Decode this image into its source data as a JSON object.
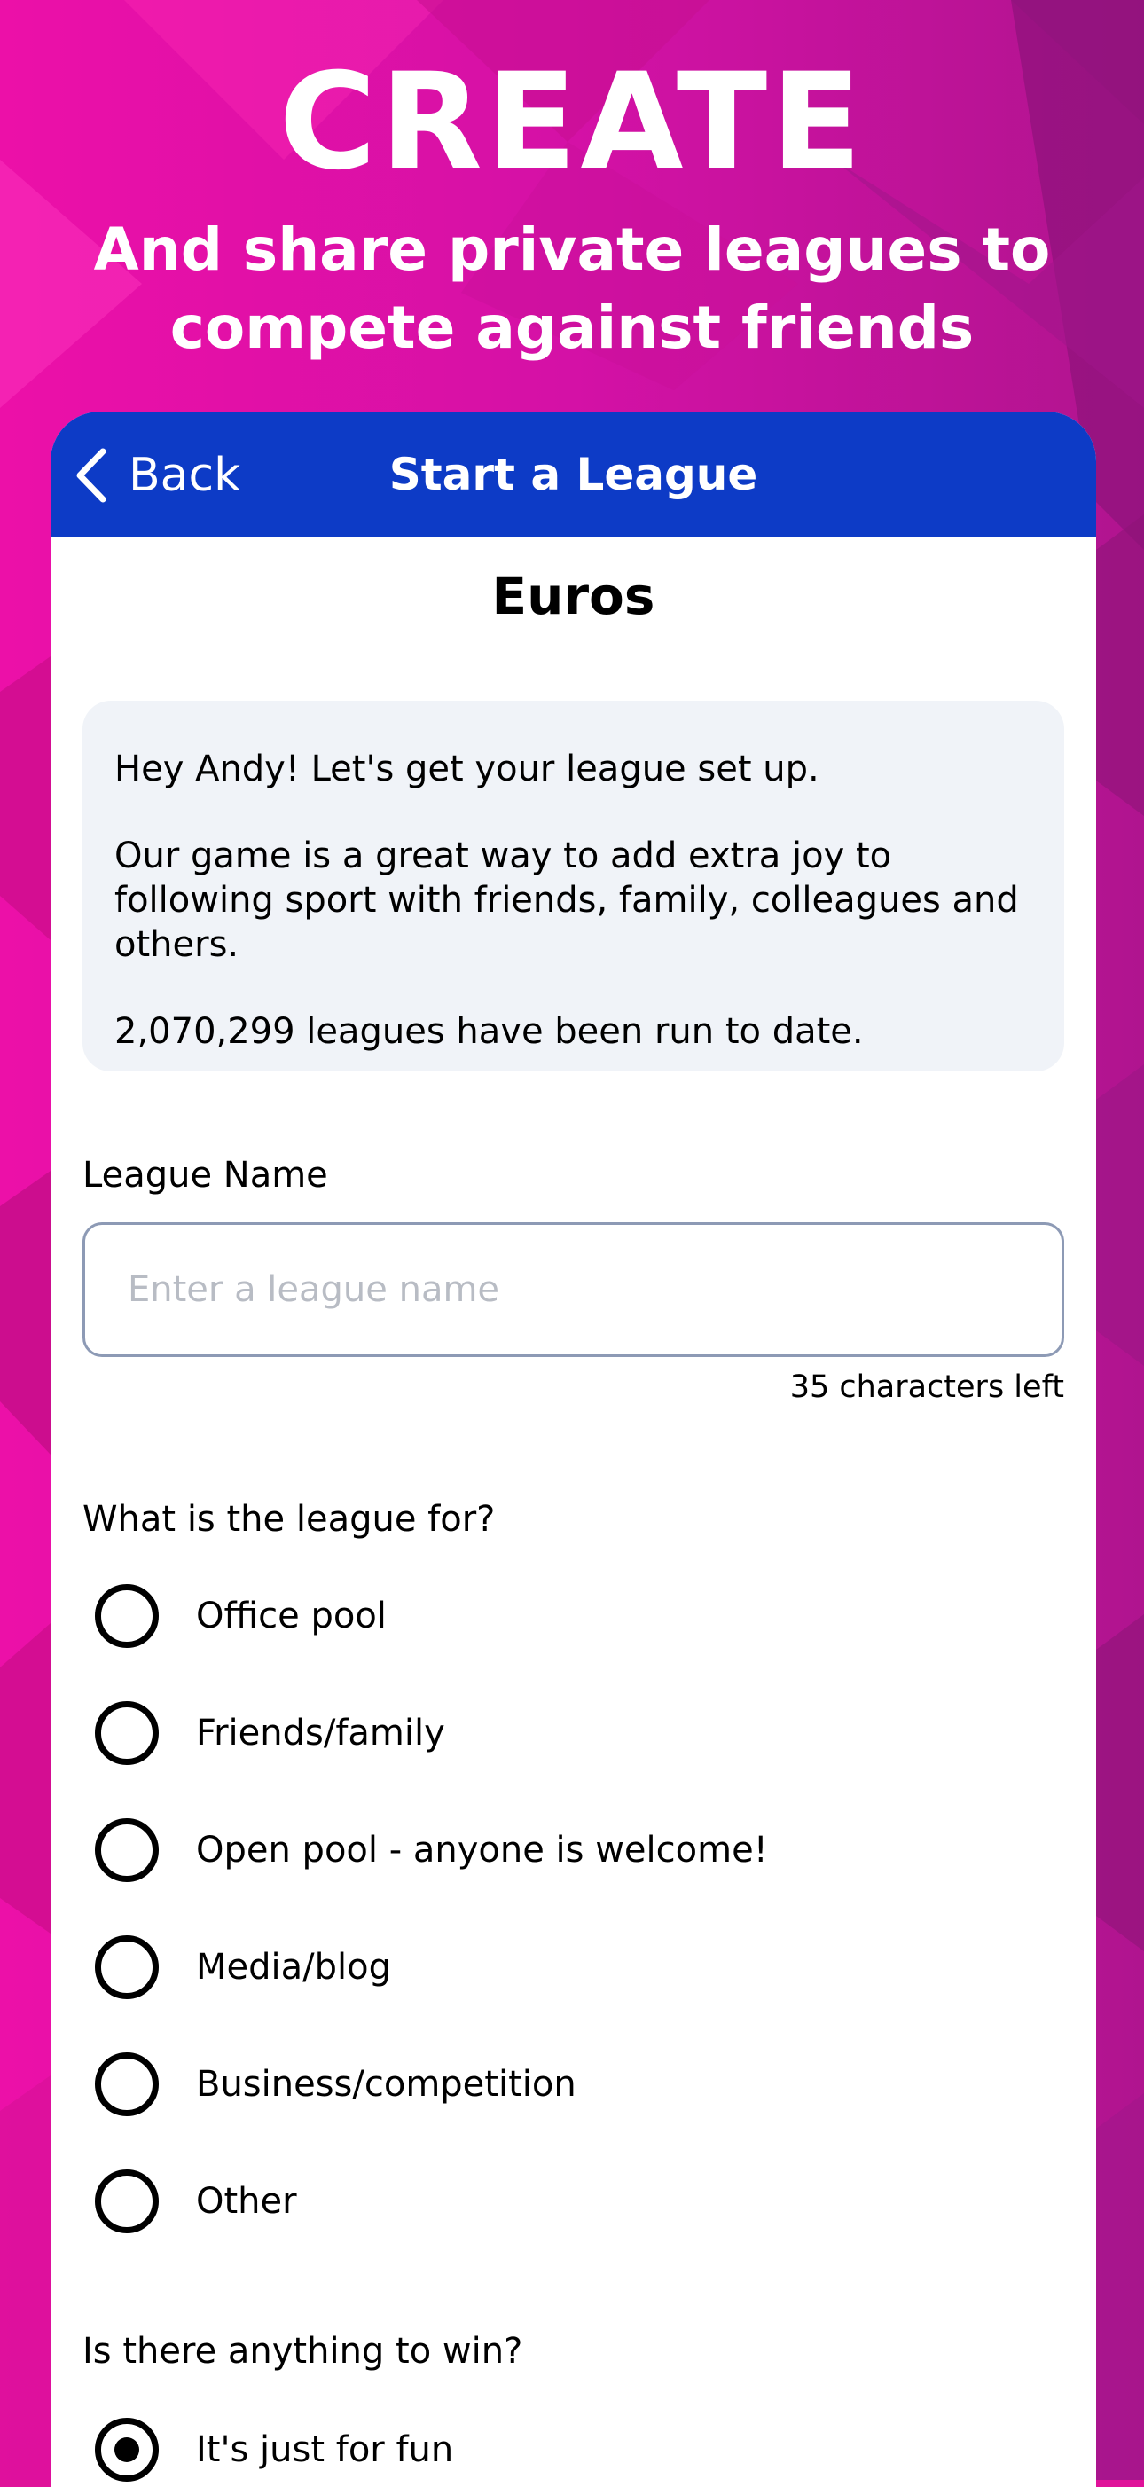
{
  "promo": {
    "title": "CREATE",
    "subtitle_line1": "And share private leagues to",
    "subtitle_line2": "compete against friends"
  },
  "colors": {
    "background_magenta": "#e0129a",
    "navbar_blue": "#0d3bc6",
    "info_box": "#f0f3f8"
  },
  "navbar": {
    "back_label": "Back",
    "back_icon": "chevron-left-icon",
    "title": "Start a League"
  },
  "competition": "Euros",
  "info": {
    "greeting": "Hey Andy! Let's get your league set up.",
    "description": "Our game is a great way to add extra joy to following sport with friends, family, colleagues and others.",
    "stats": "2,070,299 leagues have been run to date."
  },
  "league_name": {
    "label": "League Name",
    "value": "",
    "placeholder": "Enter a league name",
    "chars_left": "35 characters left"
  },
  "purpose": {
    "label": "What is the league for?",
    "options": [
      {
        "label": "Office pool",
        "checked": false
      },
      {
        "label": "Friends/family",
        "checked": false
      },
      {
        "label": "Open pool - anyone is welcome!",
        "checked": false
      },
      {
        "label": "Media/blog",
        "checked": false
      },
      {
        "label": "Business/competition",
        "checked": false
      },
      {
        "label": "Other",
        "checked": false
      }
    ]
  },
  "prize": {
    "label": "Is there anything to win?",
    "options": [
      {
        "label": "It's just for fun",
        "checked": true
      }
    ]
  }
}
